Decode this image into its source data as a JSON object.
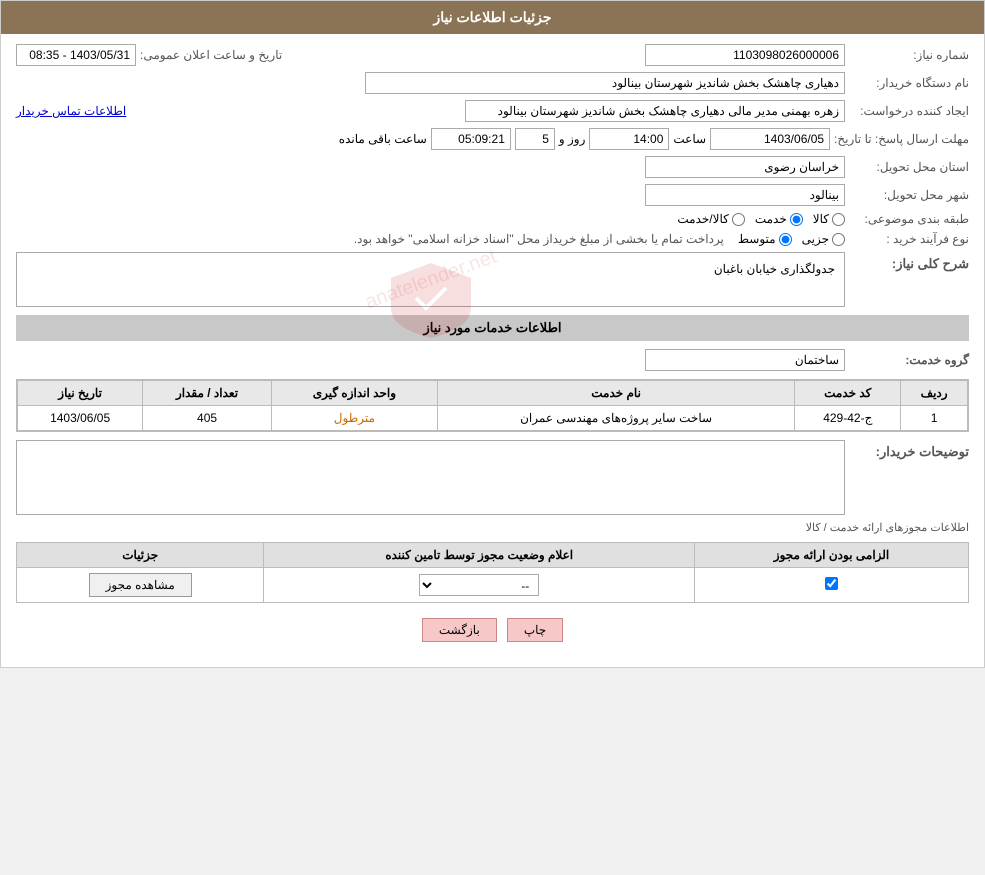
{
  "header": {
    "title": "جزئیات اطلاعات نیاز"
  },
  "fields": {
    "shomareNiaz_label": "شماره نیاز:",
    "shomareNiaz_value": "1103098026000006",
    "namDastgah_label": "نام دستگاه خریدار:",
    "namDastgah_value": "دهیاری چاهشک بخش شاندیز شهرستان بینالود",
    "tarikh_label": "تاریخ و ساعت اعلان عمومی:",
    "tarikh_value": "1403/05/31 - 08:35",
    "ijadKonande_label": "ایجاد کننده درخواست:",
    "ijadKonande_value": "زهره بهمنی مدیر مالی دهیاری چاهشک بخش شاندیز شهرستان بینالود",
    "ettelaat_link": "اطلاعات تماس خریدار",
    "mohlatErsal_label": "مهلت ارسال پاسخ: تا تاریخ:",
    "mohlatErsal_date": "1403/06/05",
    "mohlatErsal_saat_label": "ساعت",
    "mohlatErsal_saat_value": "14:00",
    "mohlatErsal_roz_label": "روز و",
    "mohlatErsal_roz_value": "5",
    "mohlatErsal_mande_label": "ساعت باقی مانده",
    "mohlatErsal_mande_value": "05:09:21",
    "ostan_label": "استان محل تحویل:",
    "ostan_value": "خراسان رضوی",
    "shahr_label": "شهر محل تحویل:",
    "shahr_value": "بینالود",
    "tabaqe_label": "طبقه بندی موضوعی:",
    "tabaqe_kala": "کالا",
    "tabaqe_khedmat": "خدمت",
    "tabaqe_kala_khedmat": "کالا/خدمت",
    "tabaqe_selected": "khedmat",
    "noeFarayand_label": "نوع فرآیند خرید :",
    "noeFarayand_jezvi": "جزیی",
    "noeFarayand_motavaset": "متوسط",
    "noeFarayand_selected": "motavaset",
    "noeFarayand_desc": "پرداخت تمام یا بخشی از مبلغ خریداز محل \"اسناد خزانه اسلامی\" خواهد بود.",
    "sharh_label": "شرح کلی نیاز:",
    "sharh_value": "جدولگذاری خیابان باغبان",
    "services_title": "اطلاعات خدمات مورد نیاز",
    "grohe_khedmat_label": "گروه خدمت:",
    "grohe_khedmat_value": "ساختمان",
    "table_headers": {
      "radif": "ردیف",
      "kod_khedmat": "کد خدمت",
      "name_khedmat": "نام خدمت",
      "vahed": "واحد اندازه گیری",
      "tedadMeqdar": "تعداد / مقدار",
      "tarikh": "تاریخ نیاز"
    },
    "table_rows": [
      {
        "radif": "1",
        "kod_khedmat": "ج-42-429",
        "name_khedmat": "ساخت سایر پروژه‌های مهندسی عمران",
        "vahed": "مترطول",
        "tedadMeqdar": "405",
        "tarikh": "1403/06/05"
      }
    ],
    "tosehat_label": "توضیحات خریدار:",
    "licenses_title": "اطلاعات مجوزهای ارائه خدمت / کالا",
    "licenses_table_headers": {
      "elzami": "الزامی بودن ارائه مجوز",
      "ealam": "اعلام وضعیت مجوز توسط تامین کننده",
      "joziyat": "جزئیات"
    },
    "licenses_rows": [
      {
        "elzami": true,
        "ealam": "--",
        "joziyat": "مشاهده مجوز"
      }
    ],
    "btn_chap": "چاپ",
    "btn_bazgasht": "بازگشت"
  }
}
